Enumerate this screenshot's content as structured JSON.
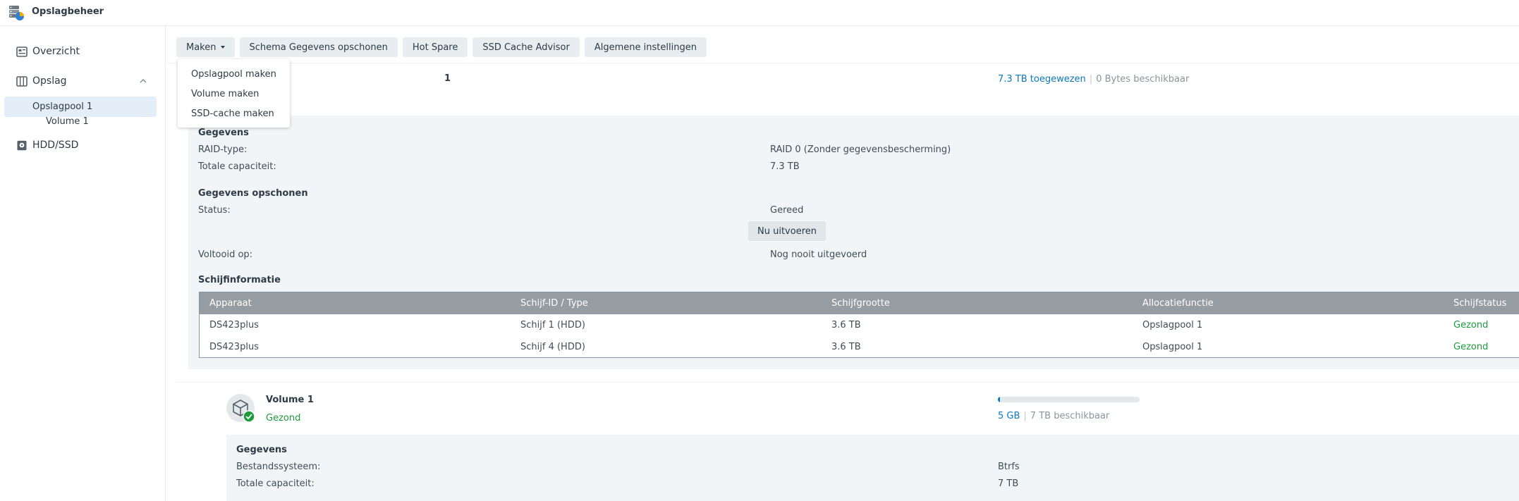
{
  "app": {
    "title": "Opslagbeheer"
  },
  "sidebar": {
    "items": [
      {
        "label": "Overzicht",
        "icon": "overview-icon"
      },
      {
        "label": "Opslag",
        "icon": "storage-icon"
      },
      {
        "label": "Opslagpool 1"
      },
      {
        "label": "Volume 1"
      },
      {
        "label": "HDD/SSD",
        "icon": "hdd-icon"
      }
    ]
  },
  "toolbar": {
    "create": "Maken",
    "scrub_schedule": "Schema Gegevens opschonen",
    "hot_spare": "Hot Spare",
    "ssd_cache_advisor": "SSD Cache Advisor",
    "general_settings": "Algemene instellingen"
  },
  "dropdown": {
    "items": [
      "Opslagpool maken",
      "Volume maken",
      "SSD-cache maken"
    ]
  },
  "pool": {
    "title_fragment": "1",
    "allocated": "7.3 TB toegewezen",
    "separator": "|",
    "available": "0 Bytes beschikbaar",
    "info": {
      "heading": "Gegevens",
      "raid_label": "RAID-type:",
      "raid_value": "RAID 0 (Zonder gegevensbescherming)",
      "capacity_label": "Totale capaciteit:",
      "capacity_value": "7.3 TB"
    },
    "scrub": {
      "heading": "Gegevens opschonen",
      "status_label": "Status:",
      "status_value": "Gereed",
      "run_button": "Nu uitvoeren",
      "completed_label": "Voltooid op:",
      "completed_value": "Nog nooit uitgevoerd"
    },
    "disks": {
      "heading": "Schijfinformatie",
      "columns": [
        "Apparaat",
        "Schijf-ID / Type",
        "Schijfgrootte",
        "Allocatiefunctie",
        "Schijfstatus"
      ],
      "rows": [
        [
          "DS423plus",
          "Schijf 1 (HDD)",
          "3.6 TB",
          "Opslagpool 1",
          "Gezond"
        ],
        [
          "DS423plus",
          "Schijf 4 (HDD)",
          "3.6 TB",
          "Opslagpool 1",
          "Gezond"
        ]
      ]
    }
  },
  "volume": {
    "name": "Volume 1",
    "status": "Gezond",
    "used": "5 GB",
    "separator": "|",
    "available": "7 TB beschikbaar",
    "usage_fraction": 0.01,
    "info": {
      "heading": "Gegevens",
      "fs_label": "Bestandssysteem:",
      "fs_value": "Btrfs",
      "capacity_label": "Totale capaciteit:",
      "capacity_value": "7 TB"
    }
  },
  "colors": {
    "accent": "#0a78be",
    "healthy": "#1d9b3a",
    "table_header": "#959ca2",
    "panel": "#f2f5f7"
  }
}
